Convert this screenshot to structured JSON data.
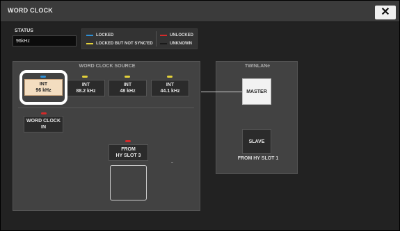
{
  "window": {
    "title": "WORD CLOCK",
    "close_symbol": "✕"
  },
  "status": {
    "label": "STATUS",
    "value": "96kHz"
  },
  "legend": {
    "locked": "LOCKED",
    "unlocked": "UNLOCKED",
    "locked_not_synced": "LOCKED BUT NOT SYNC'ED",
    "unknown": "UNKNOWN",
    "colors": {
      "locked": "#2d8fd6",
      "unlocked": "#d42a2a",
      "locked_not_synced": "#e3d13a",
      "unknown": "#1a1a1a"
    }
  },
  "word_clock_source": {
    "title": "WORD CLOCK SOURCE",
    "int_96": {
      "line1": "INT",
      "line2": "96 kHz"
    },
    "int_882": {
      "line1": "INT",
      "line2": "88.2 kHz"
    },
    "int_48": {
      "line1": "INT",
      "line2": "48 kHz"
    },
    "int_441": {
      "line1": "INT",
      "line2": "44.1 kHz"
    },
    "wc_in": {
      "line1": "WORD CLOCK",
      "line2": "IN"
    },
    "hy_slot": {
      "line1": "FROM",
      "line2": "HY SLOT 3"
    }
  },
  "twinlane": {
    "title": "TWINLANe",
    "master": "MASTER",
    "slave": "SLAVE",
    "slave_sub": "FROM HY SLOT 1"
  }
}
